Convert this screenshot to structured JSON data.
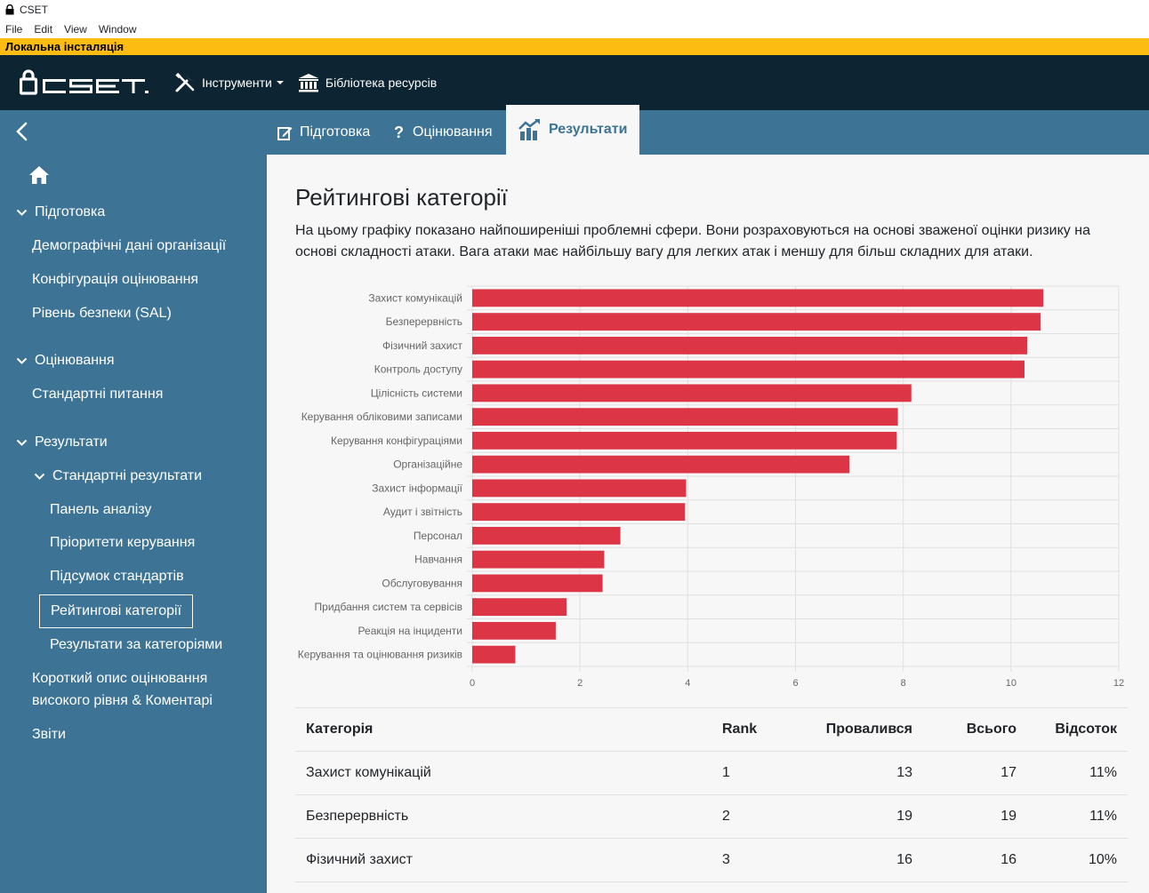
{
  "window": {
    "title": "CSET"
  },
  "menu": [
    "File",
    "Edit",
    "View",
    "Window"
  ],
  "install_banner": "Локальна інсталяція",
  "appnav": {
    "logo_text": "CSET",
    "tools_label": "Інструменти",
    "library_label": "Бібліотека ресурсів"
  },
  "tabs": {
    "prepare": "Підготовка",
    "assess": "Оцінювання",
    "results": "Результати"
  },
  "sidebar": {
    "prepare_header": "Підготовка",
    "demographics": "Демографічні дані організації",
    "config": "Конфігурація оцінювання",
    "sal": "Рівень безпеки (SAL)",
    "assess_header": "Оцінювання",
    "standard_questions": "Стандартні питання",
    "results_header": "Результати",
    "standard_results": "Стандартні результати",
    "analysis_dashboard": "Панель аналізу",
    "control_priorities": "Пріоритети керування",
    "standards_summary": "Підсумок стандартів",
    "ranked_categories": "Рейтингові категорії",
    "results_by_category": "Результати за категоріями",
    "executive_summary": "Короткий опис оцінювання високого рівня & Коментарі",
    "reports": "Звіти"
  },
  "page": {
    "title": "Рейтингові категорії",
    "intro": "На цьому графіку показано найпоширеніші проблемні сфери. Вони розраховуються на основі зваженої оцінки ризику на основі складності атаки. Вага атаки має найбільшу вагу для легких атак і меншу для більш складних для атаки."
  },
  "chart_data": {
    "type": "bar",
    "orientation": "horizontal",
    "categories": [
      "Захист комунікацій",
      "Безперервність",
      "Фізичний захист",
      "Контроль доступу",
      "Цілісність системи",
      "Керування обліковими записами",
      "Керування конфігураціями",
      "Організаційне",
      "Захист інформації",
      "Аудит і звітність",
      "Персонал",
      "Навчання",
      "Обслуговування",
      "Придбання систем та сервісів",
      "Реакція на інциденти",
      "Керування та оцінювання ризиків"
    ],
    "values": [
      10.6,
      10.55,
      10.3,
      10.25,
      8.15,
      7.9,
      7.88,
      7.0,
      3.97,
      3.95,
      2.75,
      2.45,
      2.42,
      1.75,
      1.55,
      0.8
    ],
    "xlim": [
      0,
      12
    ],
    "xticks": [
      0,
      2,
      4,
      6,
      8,
      10,
      12
    ],
    "bar_color": "#dc3545",
    "grid": true
  },
  "table": {
    "headers": [
      "Категорія",
      "Rank",
      "Провалився",
      "Всього",
      "Відсоток"
    ],
    "rows": [
      [
        "Захист комунікацій",
        "1",
        "13",
        "17",
        "11%"
      ],
      [
        "Безперервність",
        "2",
        "19",
        "19",
        "11%"
      ],
      [
        "Фізичний захист",
        "3",
        "16",
        "16",
        "10%"
      ]
    ]
  }
}
